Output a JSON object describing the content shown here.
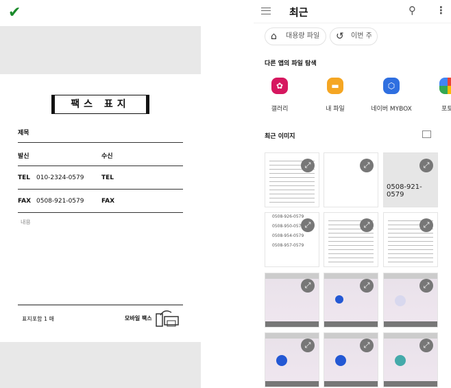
{
  "left": {
    "check_icon": "check-icon",
    "title": "팩스 표지",
    "subject_label": "제목",
    "sender_label": "발신",
    "receiver_label": "수신",
    "tel_label": "TEL",
    "sender_tel": "010-2324-0579",
    "receiver_tel_label": "TEL",
    "fax_label": "FAX",
    "sender_fax": "0508-921-0579",
    "receiver_fax_label": "FAX",
    "memo_placeholder": "내용",
    "pages": "표지포함 1 매",
    "brand": "모바일 팩스"
  },
  "right": {
    "title": "최근",
    "chips": [
      {
        "label": "대용량 파일",
        "icon": "tag-icon"
      },
      {
        "label": "이번 주",
        "icon": "history-icon"
      }
    ],
    "explore_title": "다른 앱의 파일 탐색",
    "apps": [
      {
        "label": "갤러리",
        "color": "#d6175f"
      },
      {
        "label": "내 파일",
        "color": "#f5a623"
      },
      {
        "label": "네이버 MYBOX",
        "color": "#2f6fe0"
      },
      {
        "label": "포토",
        "color": "#34a853"
      }
    ],
    "recent_images_title": "최근 이미지",
    "thumbs": {
      "fax_number": "0508-921-0579",
      "numbers": [
        "0508-926-0579",
        "0508-950-0579",
        "0508-954-0579",
        "0508-957-0579"
      ]
    }
  }
}
